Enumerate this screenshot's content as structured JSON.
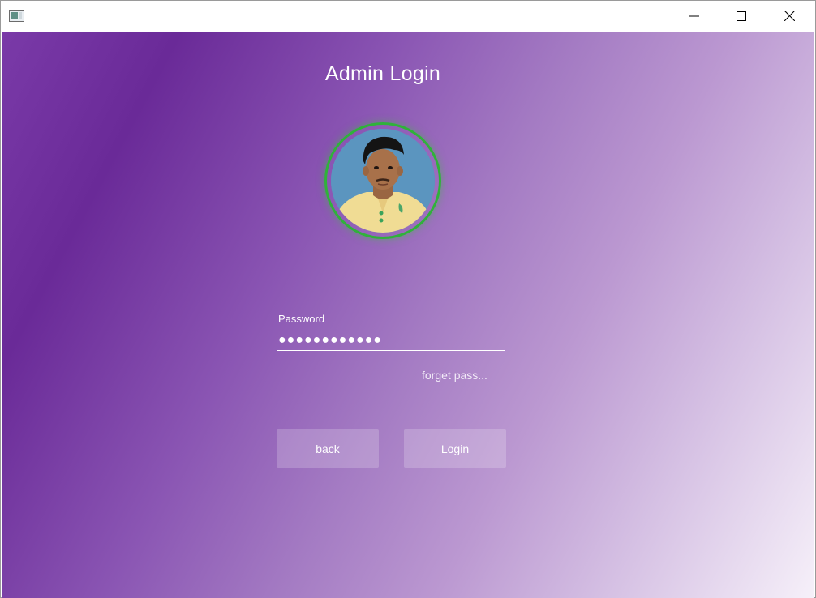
{
  "window": {
    "icon": "app-window-icon",
    "controls": {
      "minimize_icon": "minimize-icon",
      "maximize_icon": "maximize-icon",
      "close_icon": "close-icon"
    }
  },
  "login": {
    "title": "Admin Login",
    "avatar": "user-profile-photo",
    "password_label": "Password",
    "password_value": "●●●●●●●●●●●●",
    "forget_link": "forget pass...",
    "back_button": "back",
    "login_button": "Login"
  },
  "colors": {
    "accent_ring": "#2fb23a",
    "background_start": "#6a2a98",
    "background_end": "#f6f0f9"
  }
}
